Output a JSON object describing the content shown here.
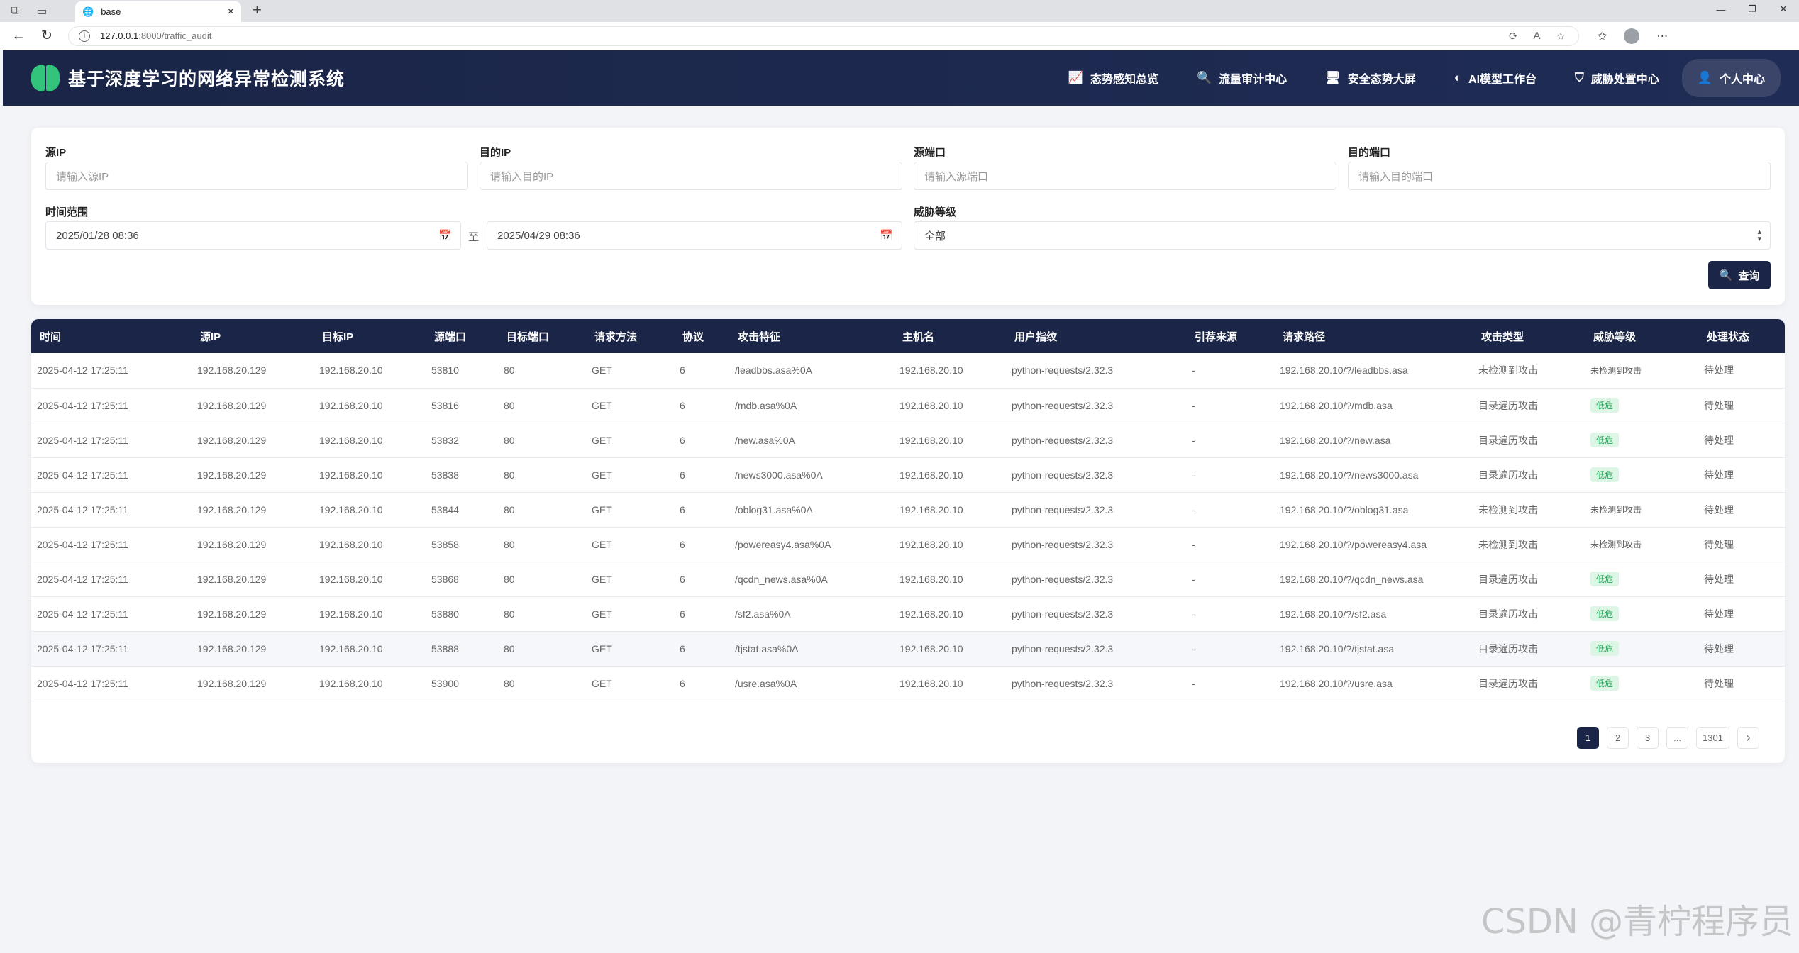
{
  "browser": {
    "tab_title": "base",
    "url_host": "127.0.0.1",
    "url_path": ":8000/traffic_audit"
  },
  "header": {
    "title": "基于深度学习的网络异常检测系统",
    "nav": [
      {
        "label": "态势感知总览",
        "icon": "chart-line-icon"
      },
      {
        "label": "流量审计中心",
        "icon": "search-icon"
      },
      {
        "label": "安全态势大屏",
        "icon": "monitor-icon"
      },
      {
        "label": "AI模型工作台",
        "icon": "brain-icon"
      },
      {
        "label": "威胁处置中心",
        "icon": "shield-icon"
      }
    ],
    "user_label": "个人中心"
  },
  "filters": {
    "src_ip": {
      "label": "源IP",
      "placeholder": "请输入源IP"
    },
    "dst_ip": {
      "label": "目的IP",
      "placeholder": "请输入目的IP"
    },
    "src_port": {
      "label": "源端口",
      "placeholder": "请输入源端口"
    },
    "dst_port": {
      "label": "目的端口",
      "placeholder": "请输入目的端口"
    },
    "time_range": {
      "label": "时间范围",
      "start": "2025/01/28 08:36",
      "separator": "至",
      "end": "2025/04/29 08:36"
    },
    "threat_level": {
      "label": "威胁等级",
      "value": "全部"
    },
    "search_label": "查询"
  },
  "table": {
    "columns": [
      "时间",
      "源IP",
      "目标IP",
      "源端口",
      "目标端口",
      "请求方法",
      "协议",
      "攻击特征",
      "主机名",
      "用户指纹",
      "引荐来源",
      "请求路径",
      "攻击类型",
      "威胁等级",
      "处理状态"
    ],
    "rows": [
      [
        "2025-04-12 17:25:11",
        "192.168.20.129",
        "192.168.20.10",
        "53810",
        "80",
        "GET",
        "6",
        "/leadbbs.asa%0A",
        "192.168.20.10",
        "python-requests/2.32.3",
        "-",
        "192.168.20.10/?/leadbbs.asa",
        "未检测到攻击",
        "未检测到攻击",
        "待处理"
      ],
      [
        "2025-04-12 17:25:11",
        "192.168.20.129",
        "192.168.20.10",
        "53816",
        "80",
        "GET",
        "6",
        "/mdb.asa%0A",
        "192.168.20.10",
        "python-requests/2.32.3",
        "-",
        "192.168.20.10/?/mdb.asa",
        "目录遍历攻击",
        "低危",
        "待处理"
      ],
      [
        "2025-04-12 17:25:11",
        "192.168.20.129",
        "192.168.20.10",
        "53832",
        "80",
        "GET",
        "6",
        "/new.asa%0A",
        "192.168.20.10",
        "python-requests/2.32.3",
        "-",
        "192.168.20.10/?/new.asa",
        "目录遍历攻击",
        "低危",
        "待处理"
      ],
      [
        "2025-04-12 17:25:11",
        "192.168.20.129",
        "192.168.20.10",
        "53838",
        "80",
        "GET",
        "6",
        "/news3000.asa%0A",
        "192.168.20.10",
        "python-requests/2.32.3",
        "-",
        "192.168.20.10/?/news3000.asa",
        "目录遍历攻击",
        "低危",
        "待处理"
      ],
      [
        "2025-04-12 17:25:11",
        "192.168.20.129",
        "192.168.20.10",
        "53844",
        "80",
        "GET",
        "6",
        "/oblog31.asa%0A",
        "192.168.20.10",
        "python-requests/2.32.3",
        "-",
        "192.168.20.10/?/oblog31.asa",
        "未检测到攻击",
        "未检测到攻击",
        "待处理"
      ],
      [
        "2025-04-12 17:25:11",
        "192.168.20.129",
        "192.168.20.10",
        "53858",
        "80",
        "GET",
        "6",
        "/powereasy4.asa%0A",
        "192.168.20.10",
        "python-requests/2.32.3",
        "-",
        "192.168.20.10/?/powereasy4.asa",
        "未检测到攻击",
        "未检测到攻击",
        "待处理"
      ],
      [
        "2025-04-12 17:25:11",
        "192.168.20.129",
        "192.168.20.10",
        "53868",
        "80",
        "GET",
        "6",
        "/qcdn_news.asa%0A",
        "192.168.20.10",
        "python-requests/2.32.3",
        "-",
        "192.168.20.10/?/qcdn_news.asa",
        "目录遍历攻击",
        "低危",
        "待处理"
      ],
      [
        "2025-04-12 17:25:11",
        "192.168.20.129",
        "192.168.20.10",
        "53880",
        "80",
        "GET",
        "6",
        "/sf2.asa%0A",
        "192.168.20.10",
        "python-requests/2.32.3",
        "-",
        "192.168.20.10/?/sf2.asa",
        "目录遍历攻击",
        "低危",
        "待处理"
      ],
      [
        "2025-04-12 17:25:11",
        "192.168.20.129",
        "192.168.20.10",
        "53888",
        "80",
        "GET",
        "6",
        "/tjstat.asa%0A",
        "192.168.20.10",
        "python-requests/2.32.3",
        "-",
        "192.168.20.10/?/tjstat.asa",
        "目录遍历攻击",
        "低危",
        "待处理"
      ],
      [
        "2025-04-12 17:25:11",
        "192.168.20.129",
        "192.168.20.10",
        "53900",
        "80",
        "GET",
        "6",
        "/usre.asa%0A",
        "192.168.20.10",
        "python-requests/2.32.3",
        "-",
        "192.168.20.10/?/usre.asa",
        "目录遍历攻击",
        "低危",
        "待处理"
      ]
    ]
  },
  "pagination": {
    "pages": [
      "1",
      "2",
      "3",
      "...",
      "1301"
    ],
    "current": "1",
    "next": "›"
  },
  "watermark": "CSDN @青柠程序员",
  "colors": {
    "header_bg": "#1a2547",
    "accent_green": "#32c47a",
    "low_badge_bg": "#dcf5e4",
    "low_badge_text": "#27a35a"
  }
}
